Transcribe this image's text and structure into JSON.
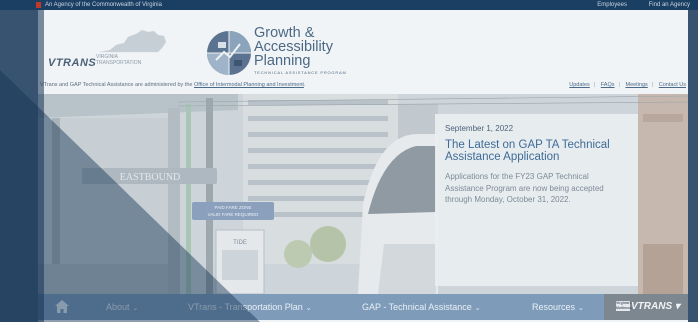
{
  "topbar": {
    "agency": "An Agency of the Commonwealth of Virginia",
    "links": [
      "Employees",
      "Find an Agency"
    ]
  },
  "header": {
    "vtrans_word": "VTRANS",
    "vtrans_sub_1": "VIRGINIA",
    "vtrans_sub_2": "TRANSPORTATION",
    "gap_line_1": "Growth &",
    "gap_line_2": "Accessibility",
    "gap_line_3": "Planning",
    "gap_tag": "TECHNICAL ASSISTANCE PROGRAM",
    "admin_text": "VTrans and GAP Technical Assistance are administered by the ",
    "admin_link": "Office of Intermodal Planning and Investment",
    "admin_end": ".",
    "util_links": [
      "Updates",
      "FAQs",
      "Meetings",
      "Contact Us"
    ]
  },
  "hero": {
    "station_sign": "EASTBOUND",
    "fare_sign_1": "PAID FARE ZONE",
    "fare_sign_2": "VALID FARE REQUIRED",
    "info_sign": "TIDE"
  },
  "news": {
    "date": "September 1, 2022",
    "title": "The Latest on GAP TA Technical Assistance Application",
    "body": "Applications for the FY23 GAP Technical Assistance Program are now being accepted through Monday, October 31, 2022."
  },
  "nav": {
    "items": [
      "About",
      "VTrans - Transportation Plan",
      "GAP - Technical Assistance",
      "Resources"
    ],
    "chevron": "⌄",
    "vtrans_badge_1": "Virginia's",
    "vtrans_badge_2": "Multimodal",
    "vtrans_word": "VTRANS",
    "vtrans_chevron": "▾"
  },
  "icons": {
    "home": "home-icon",
    "flag": "virginia-flag-icon",
    "map": "virginia-map-icon",
    "emblem": "gap-emblem-icon"
  },
  "colors": {
    "topbar": "#1b3e63",
    "nav": "#7e9cba",
    "accent": "#3f6b98"
  }
}
